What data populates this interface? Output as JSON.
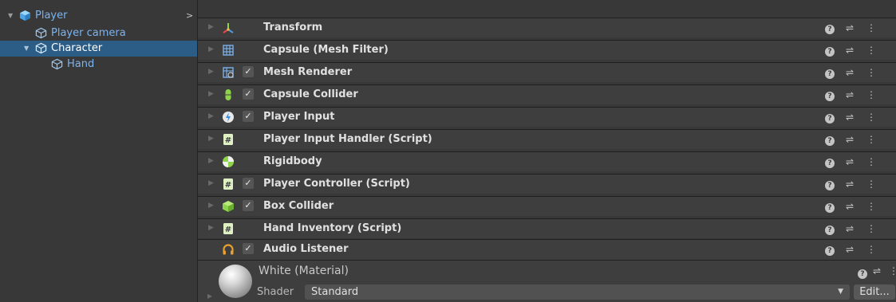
{
  "hierarchy": {
    "items": [
      {
        "label": "Player",
        "icon": "prefab-cube-icon",
        "expanded": true,
        "selected": false
      },
      {
        "label": "Player camera",
        "icon": "gameobject-cube-icon",
        "expanded": false,
        "selected": false
      },
      {
        "label": "Character",
        "icon": "gameobject-cube-icon",
        "expanded": true,
        "selected": true
      },
      {
        "label": "Hand",
        "icon": "gameobject-cube-icon",
        "expanded": false,
        "selected": false
      }
    ],
    "more_arrow": ">"
  },
  "inspector": {
    "components": [
      {
        "name": "Transform",
        "icon": "transform-icon",
        "has_checkbox": false,
        "checked": false,
        "icon_color": "#e8c24a"
      },
      {
        "name": "Capsule (Mesh Filter)",
        "icon": "mesh-filter-icon",
        "has_checkbox": false,
        "checked": false,
        "icon_color": "#7ab0e8"
      },
      {
        "name": "Mesh Renderer",
        "icon": "mesh-renderer-icon",
        "has_checkbox": true,
        "checked": true,
        "icon_color": "#7ab0e8"
      },
      {
        "name": "Capsule Collider",
        "icon": "capsule-collider-icon",
        "has_checkbox": true,
        "checked": true,
        "icon_color": "#8ed44a"
      },
      {
        "name": "Player Input",
        "icon": "player-input-icon",
        "has_checkbox": true,
        "checked": true,
        "icon_color": "#4aa0e8"
      },
      {
        "name": "Player Input Handler (Script)",
        "icon": "script-icon",
        "has_checkbox": false,
        "checked": false,
        "icon_color": "#cfe8a0"
      },
      {
        "name": "Rigidbody",
        "icon": "rigidbody-icon",
        "has_checkbox": false,
        "checked": false,
        "icon_color": "#8ed44a"
      },
      {
        "name": "Player Controller (Script)",
        "icon": "script-icon",
        "has_checkbox": true,
        "checked": true,
        "icon_color": "#cfe8a0"
      },
      {
        "name": "Box Collider",
        "icon": "box-collider-icon",
        "has_checkbox": true,
        "checked": true,
        "icon_color": "#8ed44a"
      },
      {
        "name": "Hand Inventory (Script)",
        "icon": "script-icon",
        "has_checkbox": false,
        "checked": false,
        "icon_color": "#cfe8a0"
      },
      {
        "name": "Audio Listener",
        "icon": "audio-listener-icon",
        "has_checkbox": true,
        "checked": true,
        "icon_color": "#e8a030"
      }
    ],
    "help_icon": "help-icon",
    "preset_icon": "preset-icon",
    "menu_icon": "kebab-menu-icon",
    "material": {
      "name": "White (Material)",
      "shader_label": "Shader",
      "shader_value": "Standard",
      "edit_label": "Edit..."
    }
  },
  "colors": {
    "selection": "#2c5d87",
    "hierarchy_text": "#7cb4f0"
  }
}
